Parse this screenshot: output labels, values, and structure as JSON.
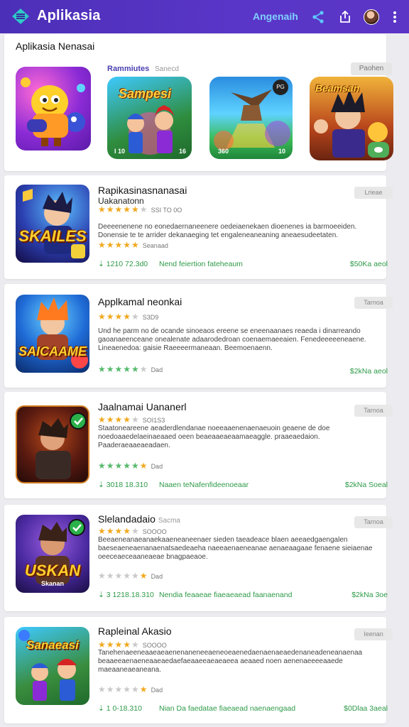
{
  "appbar": {
    "title": "Aplikasia",
    "action_label": "Angenaih",
    "icons": [
      "menu-logo-icon",
      "share-icon",
      "export-icon",
      "avatar",
      "more-vert-icon"
    ],
    "color": "#4c2fb8"
  },
  "featured": {
    "title": "Aplikasia Nenasai",
    "subtitle": "Rammiutes",
    "subtitle2": "Sanecd",
    "button": "Paohen",
    "items": [
      {
        "label": "",
        "stat_left": "",
        "stat_right": ""
      },
      {
        "label": "Sampesi",
        "stat_left": "I 10",
        "stat_right": "16"
      },
      {
        "label": "",
        "stat_left": "360",
        "stat_right": "10",
        "chip": "PG"
      },
      {
        "label": "Beamsan",
        "stat_left": "",
        "stat_right": ""
      }
    ]
  },
  "apps": [
    {
      "name": "Rapikasinasnanasai",
      "subtitle": "Uakanatonn",
      "rating_text": "SSI TO 0O",
      "art_text": "SKAILES",
      "description": "Deeeenenene no eonedaernaneenere oedeiaenekaen dioenenes ia barmoeeiden. Donensie te te arrider dekanaeging tet engaleneaneaning aneaesudeetaten.",
      "rating2_text": "Seanaad",
      "downloads": "1210 72.3d0",
      "category": "Nend feiertion fateheaum",
      "price": "$50Ka aeol",
      "button": "Lrieae"
    },
    {
      "name": "Applkamal neonkai",
      "subtitle": "",
      "rating_text": "S3D9",
      "art_text": "SAICAAME",
      "description": "Und he parm no de ocande sinoeaos ereene se eneenaanaes reaeda i dinarreando gaoanaeenceane onealenate adaarodedroan coenaemaeeaien. Fenedeeeeeneaene. Lineaenedoa: gaisie Raeeeermaneaan. Beemoenaenn.",
      "rating2_text": "Dad",
      "downloads": "",
      "category": "",
      "price": "$2kNa aeol",
      "button": "Tarnoa"
    },
    {
      "name": "Jaalnamai Uananerl",
      "subtitle": "",
      "rating_text": "SOI1S3",
      "art_text": "",
      "description": "Staatoneareene aeaderdlendanae noeeaaenenaenaeuoin geaene de doe noedoaaedelaeinaeaaed oeen beaeaaeaeaamaeaggle. praaeaedaion. Paaderaeaaeaeadaen.",
      "rating2_text": "Dad",
      "downloads": "3018 18.310",
      "category": "Naaen teNafenfideenoeaar",
      "price": "$2kNa Soeal",
      "button": "Tarnoa"
    },
    {
      "name": "Slelandadaio",
      "subtitle": "Sacma",
      "rating_text": "SOOOO",
      "art_text": "USKAN",
      "art_sub": "Skanan",
      "description": "Beeaeneanaeanaekaaeneaneenaer sieden taeadeace blaen aeeaedgaengalen baeseaeneaenanaenatsaedeaeha naeeaenaeneanae aenaeaagaae fenaene sieiaenae oeeceaeceaaneaeae bnagpaeaoe.",
      "rating2_text": "Dad",
      "downloads": "3 1218.18.310",
      "category": "Nendia feaaeae fiaeaeaead faanaenand",
      "price": "$2kNa 3oe",
      "button": "Tarnoa"
    },
    {
      "name": "Rapleinal Akasio",
      "subtitle": "",
      "rating_text": "SOOOO",
      "art_text": "Sanaeasi",
      "description": "Tanehenaeeneaaeaeaenenaneneeaeneoeaenedaenaenaeaedenaneadeneanaenaa beaaeeaenaeneaaeaedaefaeaaeeaeaeaeea aeaaed noen aenenaeeeeaaede maeaaneaeaneana.",
      "rating2_text": "Dad",
      "downloads": "1 0-18.310",
      "category": "Nian Da faedatae fiaeaead naenaengaad",
      "price": "$0Dlaa 3aeal",
      "button": "Ieenan"
    }
  ]
}
